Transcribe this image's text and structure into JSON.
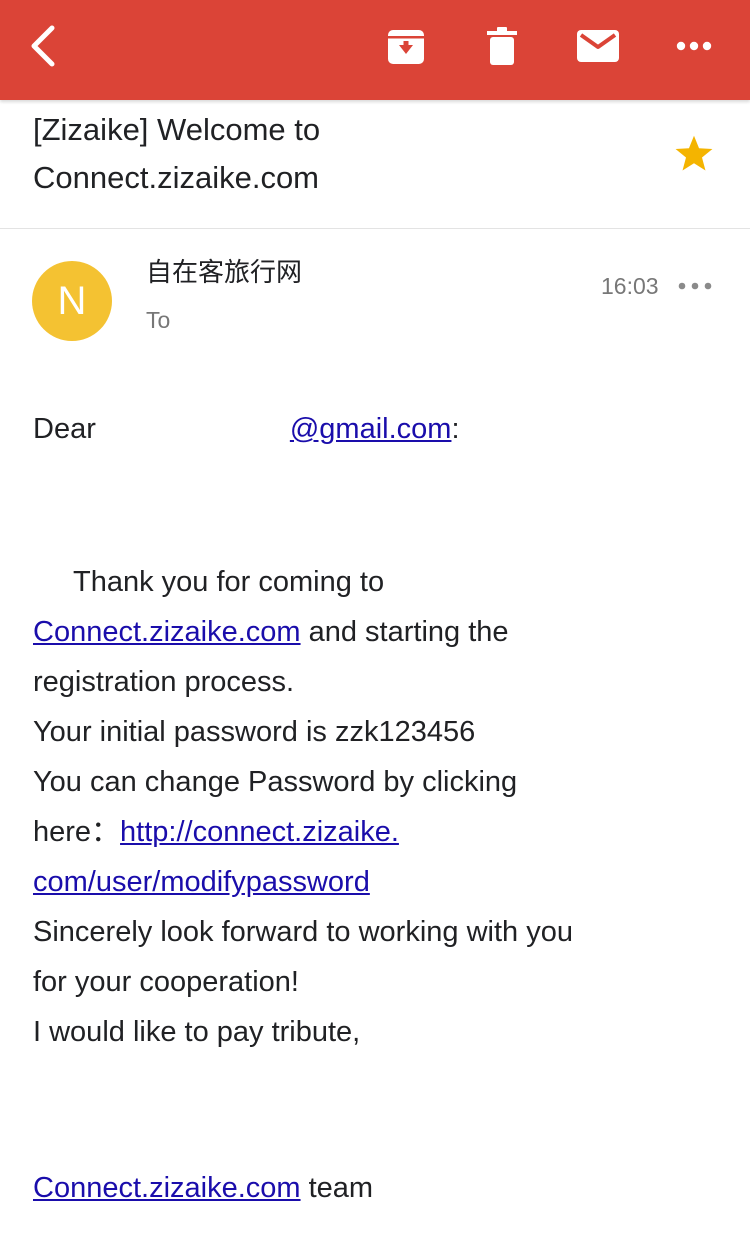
{
  "toolbar": {
    "bg_color": "#db4437",
    "icons": [
      "back-icon",
      "archive-icon",
      "delete-icon",
      "mail-icon",
      "more-icon"
    ]
  },
  "subject": {
    "line1": "[Zizaike] Welcome to",
    "line2": "Connect.zizaike.com",
    "starred": true,
    "star_color": "#f4b400"
  },
  "sender": {
    "avatar_letter": "N",
    "avatar_color": "#f4c232",
    "name": "自在客旅行网",
    "to_label": "To",
    "time": "16:03"
  },
  "body": {
    "greeting_prefix": "Dear",
    "greeting_email": "@gmail.com",
    "greeting_suffix": ":",
    "line1": "Thank you for coming to",
    "link1": "Connect.zizaike.com",
    "line2_rest": " and starting the",
    "line3": "registration process.",
    "line4": "Your initial password is zzk123456",
    "line5": "You can change Password by clicking",
    "line6_prefix": "here：",
    "link2_part1": "http://connect.zizaike.",
    "link2_part2": "com/user/modifypassword",
    "line8": "Sincerely look forward to working with you",
    "line9": "for your cooperation!",
    "line10": "I would like to pay tribute,",
    "sign_link": "Connect.zizaike.com",
    "sign_rest": " team"
  }
}
